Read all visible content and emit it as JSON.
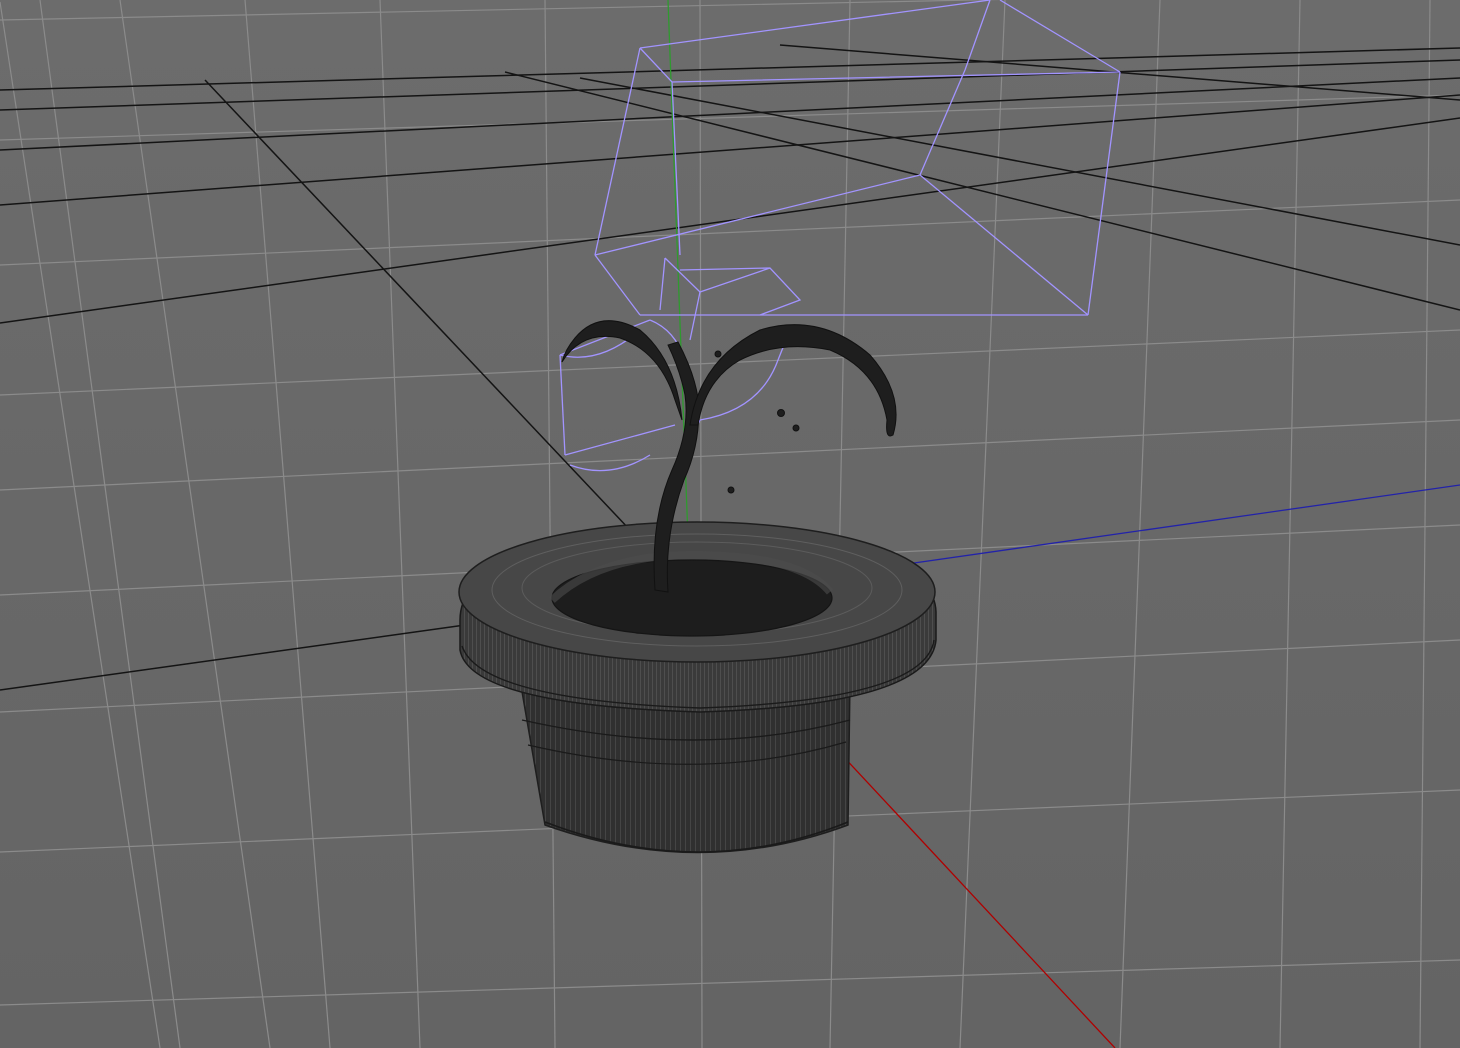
{
  "viewport": {
    "background": "#6a6a6a",
    "projection": "perspective",
    "shading": "wireframe-on-shaded",
    "grid": true
  },
  "colors": {
    "grid_minor": "#8a8a8a",
    "grid_major": "#111111",
    "axis_x": "#b00000",
    "axis_y": "#25a025",
    "axis_z": "#2020b0",
    "camera_wireframe": "#9c8cff",
    "object_fill": "#2a2a2a",
    "object_edges": "#555555"
  },
  "objects": [
    {
      "name": "flower-pot",
      "icon": "pot-mesh-icon",
      "display": "wireframe-shaded"
    },
    {
      "name": "sprout-plant",
      "icon": "plant-mesh-icon",
      "display": "solid-dark"
    },
    {
      "name": "camera-large",
      "icon": "camera-frustum-icon",
      "display": "wireframe"
    },
    {
      "name": "camera-small",
      "icon": "camera-frustum-icon",
      "display": "wireframe"
    }
  ]
}
